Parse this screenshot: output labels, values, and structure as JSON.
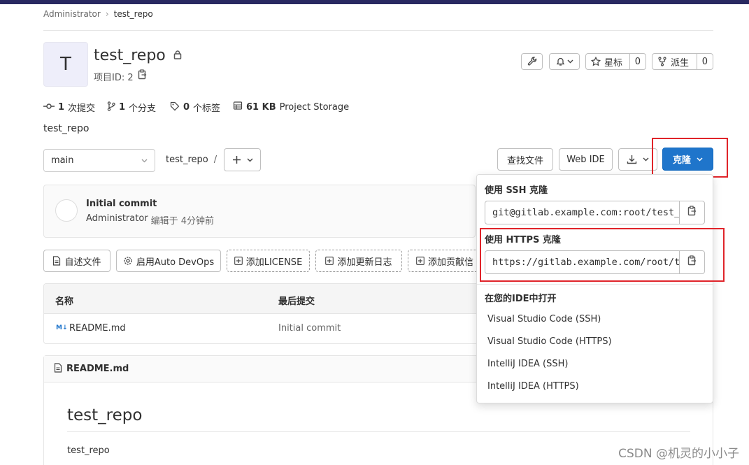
{
  "breadcrumb": {
    "parent": "Administrator",
    "sep": "›",
    "current": "test_repo"
  },
  "project": {
    "avatar_letter": "T",
    "name": "test_repo",
    "id_label": "项目ID: 2",
    "description": "test_repo"
  },
  "header_actions": {
    "star_label": "星标",
    "star_count": "0",
    "fork_label": "派生",
    "fork_count": "0"
  },
  "stats": {
    "commits_count": "1",
    "commits_label": "次提交",
    "branches_count": "1",
    "branches_label": "个分支",
    "tags_count": "0",
    "tags_label": "个标签",
    "storage_size": "61 KB",
    "storage_label": "Project Storage"
  },
  "toolbar": {
    "branch": "main",
    "path": "test_repo",
    "path_sep": "/",
    "find_file": "查找文件",
    "web_ide": "Web IDE",
    "clone": "克隆"
  },
  "commit": {
    "title": "Initial commit",
    "author": "Administrator",
    "meta": "编辑于 4分钟前"
  },
  "quick_actions": {
    "readme": "自述文件",
    "auto_devops": "启用Auto DevOps",
    "license": "添加LICENSE",
    "changelog": "添加更新日志",
    "contributing": "添加贡献信"
  },
  "file_table": {
    "col_name": "名称",
    "col_last_commit": "最后提交",
    "rows": [
      {
        "name": "README.md",
        "commit": "Initial commit"
      }
    ]
  },
  "readme": {
    "file_name": "README.md",
    "heading": "test_repo",
    "body": "test_repo"
  },
  "clone_dropdown": {
    "ssh_title": "使用 SSH 克隆",
    "ssh_url": "git@gitlab.example.com:root/test_repo.git",
    "https_title": "使用 HTTPS 克隆",
    "https_url": "https://gitlab.example.com/root/test_repo.git",
    "ide_title": "在您的IDE中打开",
    "ide_options": [
      "Visual Studio Code (SSH)",
      "Visual Studio Code (HTTPS)",
      "IntelliJ IDEA (SSH)",
      "IntelliJ IDEA (HTTPS)"
    ]
  },
  "watermark": "CSDN @机灵的小小子",
  "colors": {
    "primary": "#1f75cb",
    "highlight": "#e0242a",
    "topbar": "#292961"
  }
}
